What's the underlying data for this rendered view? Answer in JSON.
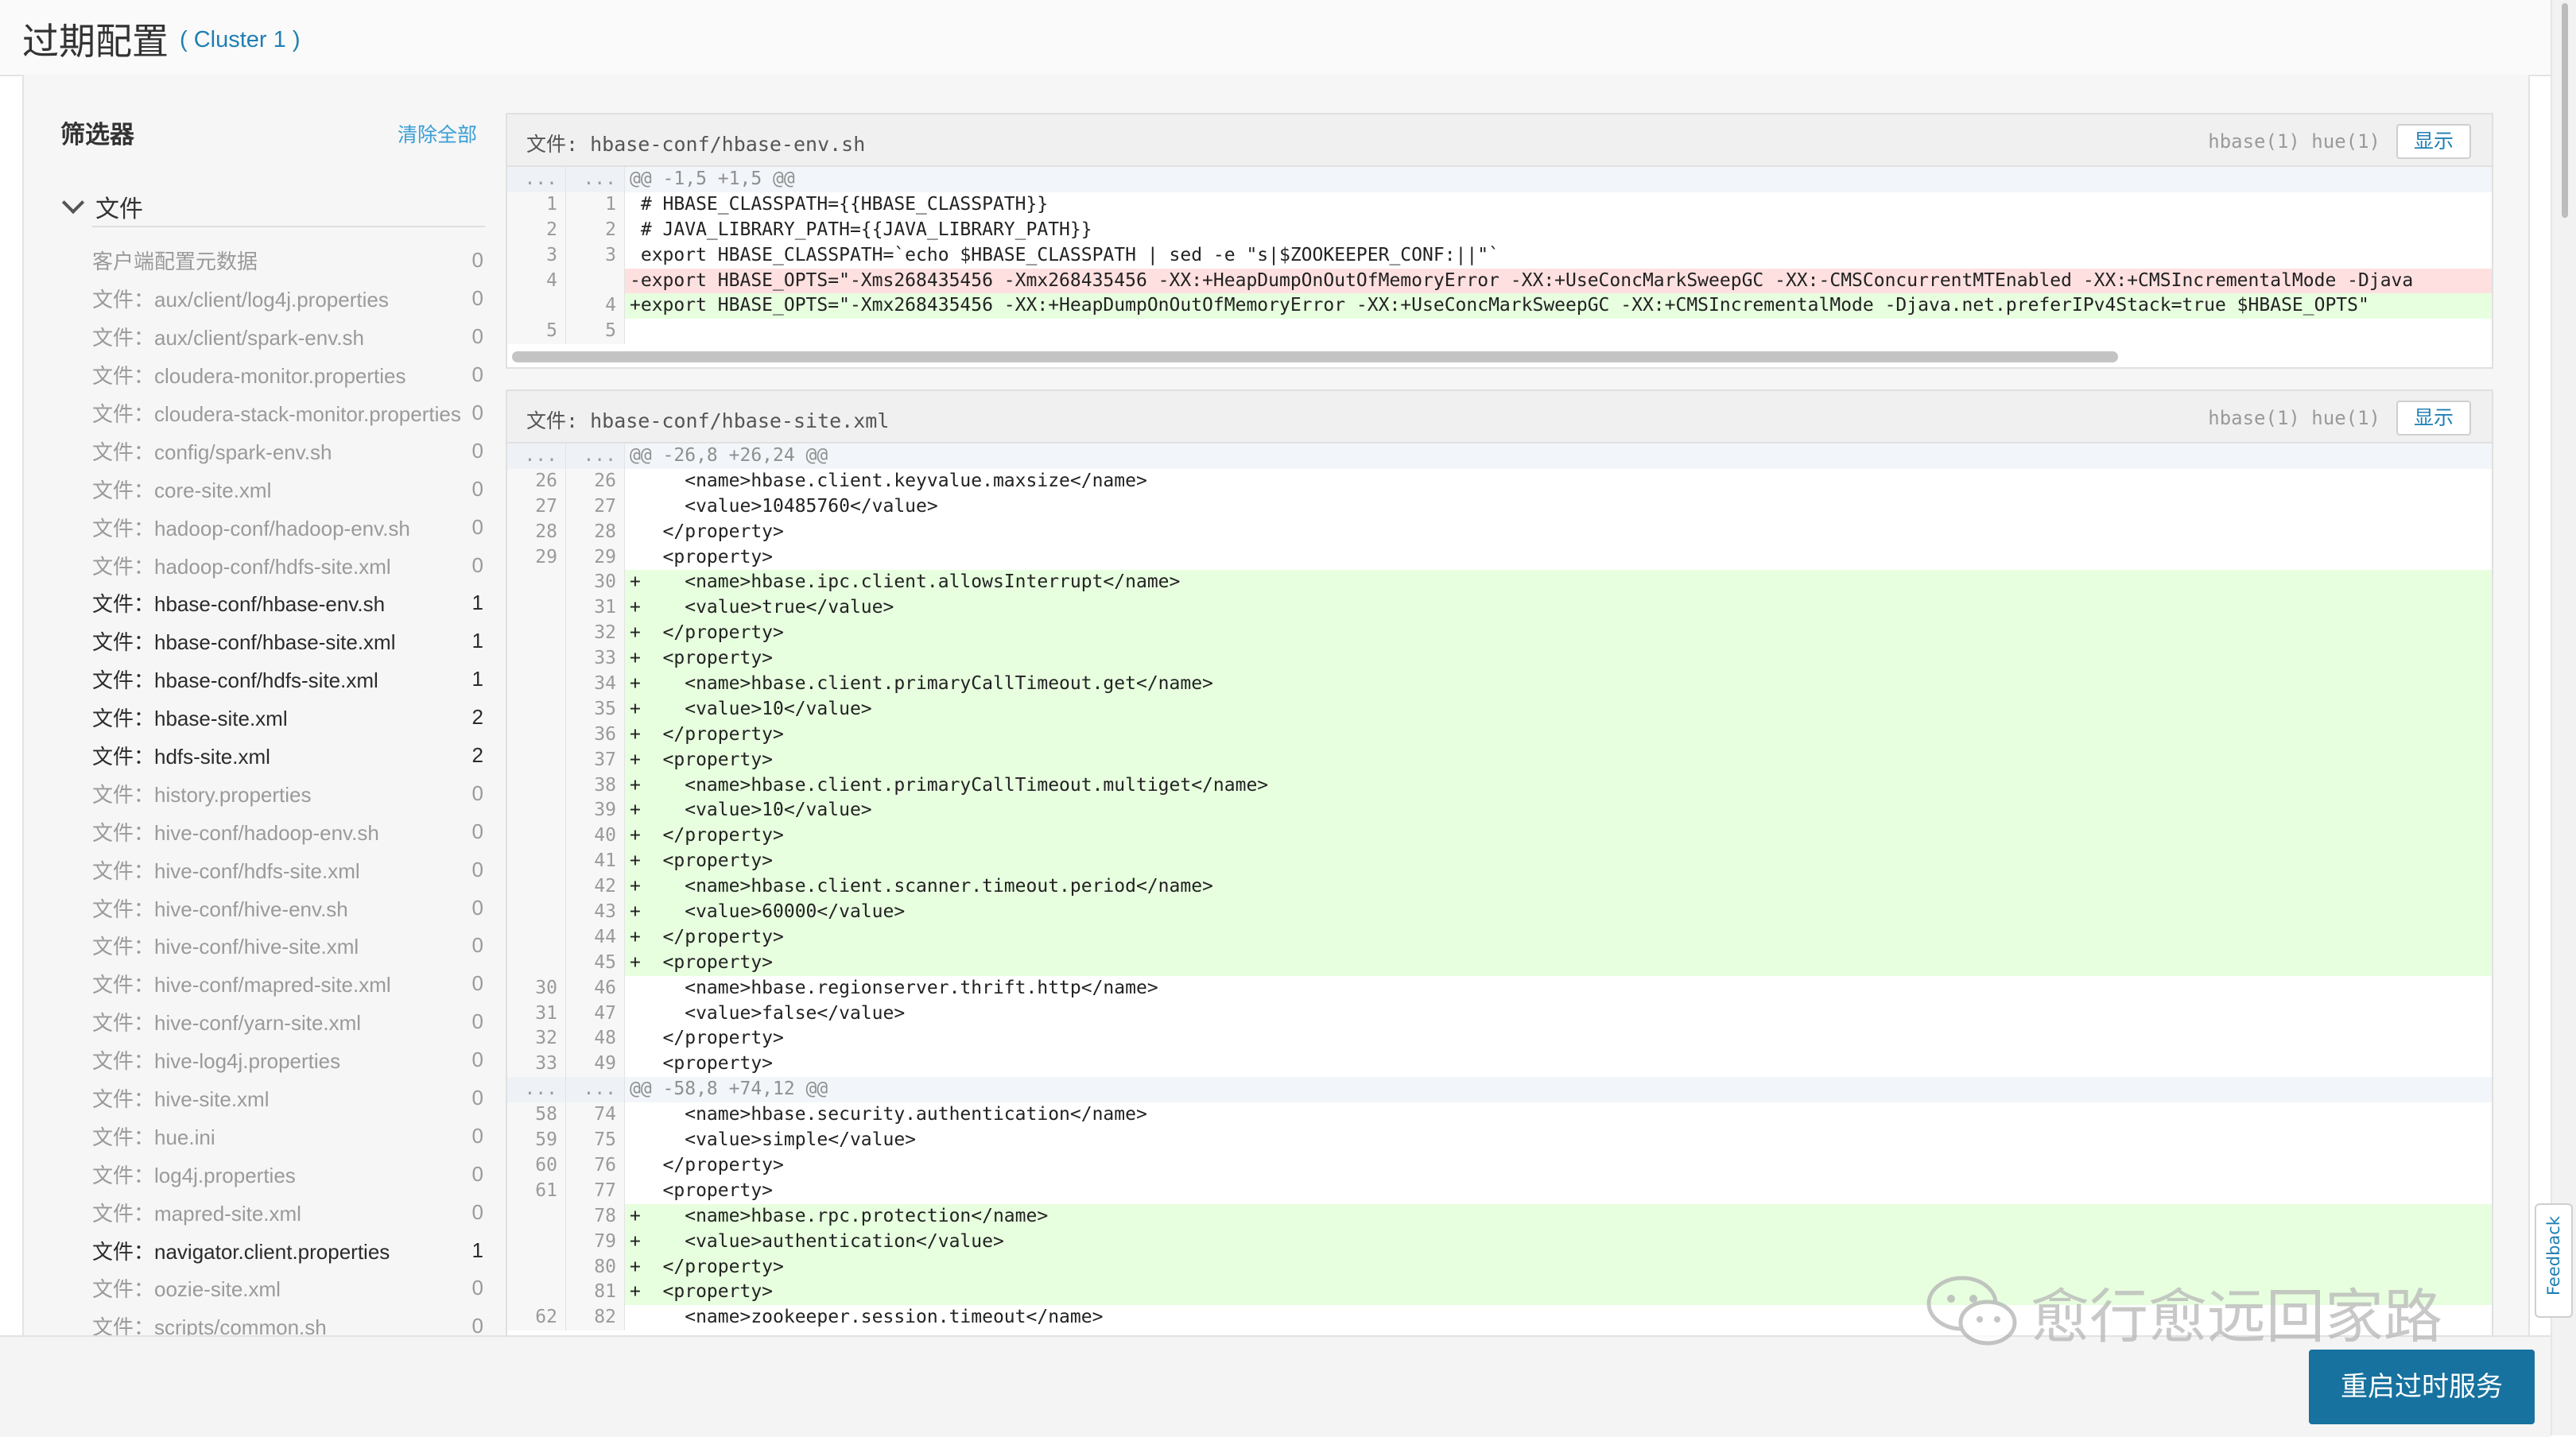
{
  "page": {
    "title": "过期配置",
    "cluster": "( Cluster 1 )"
  },
  "sidebar": {
    "filter_title": "筛选器",
    "clear_all": "清除全部",
    "section_title": "文件",
    "items": [
      {
        "label": "客户端配置元数据",
        "count": "0",
        "active": false
      },
      {
        "label": "文件：aux/client/log4j.properties",
        "count": "0",
        "active": false
      },
      {
        "label": "文件：aux/client/spark-env.sh",
        "count": "0",
        "active": false
      },
      {
        "label": "文件：cloudera-monitor.properties",
        "count": "0",
        "active": false
      },
      {
        "label": "文件：cloudera-stack-monitor.properties",
        "count": "0",
        "active": false
      },
      {
        "label": "文件：config/spark-env.sh",
        "count": "0",
        "active": false
      },
      {
        "label": "文件：core-site.xml",
        "count": "0",
        "active": false
      },
      {
        "label": "文件：hadoop-conf/hadoop-env.sh",
        "count": "0",
        "active": false
      },
      {
        "label": "文件：hadoop-conf/hdfs-site.xml",
        "count": "0",
        "active": false
      },
      {
        "label": "文件：hbase-conf/hbase-env.sh",
        "count": "1",
        "active": true
      },
      {
        "label": "文件：hbase-conf/hbase-site.xml",
        "count": "1",
        "active": true
      },
      {
        "label": "文件：hbase-conf/hdfs-site.xml",
        "count": "1",
        "active": true
      },
      {
        "label": "文件：hbase-site.xml",
        "count": "2",
        "active": true
      },
      {
        "label": "文件：hdfs-site.xml",
        "count": "2",
        "active": true
      },
      {
        "label": "文件：history.properties",
        "count": "0",
        "active": false
      },
      {
        "label": "文件：hive-conf/hadoop-env.sh",
        "count": "0",
        "active": false
      },
      {
        "label": "文件：hive-conf/hdfs-site.xml",
        "count": "0",
        "active": false
      },
      {
        "label": "文件：hive-conf/hive-env.sh",
        "count": "0",
        "active": false
      },
      {
        "label": "文件：hive-conf/hive-site.xml",
        "count": "0",
        "active": false
      },
      {
        "label": "文件：hive-conf/mapred-site.xml",
        "count": "0",
        "active": false
      },
      {
        "label": "文件：hive-conf/yarn-site.xml",
        "count": "0",
        "active": false
      },
      {
        "label": "文件：hive-log4j.properties",
        "count": "0",
        "active": false
      },
      {
        "label": "文件：hive-site.xml",
        "count": "0",
        "active": false
      },
      {
        "label": "文件：hue.ini",
        "count": "0",
        "active": false
      },
      {
        "label": "文件：log4j.properties",
        "count": "0",
        "active": false
      },
      {
        "label": "文件：mapred-site.xml",
        "count": "0",
        "active": false
      },
      {
        "label": "文件：navigator.client.properties",
        "count": "1",
        "active": true
      },
      {
        "label": "文件：oozie-site.xml",
        "count": "0",
        "active": false
      },
      {
        "label": "文件：scripts/common.sh",
        "count": "0",
        "active": false
      }
    ]
  },
  "panels": [
    {
      "file": "文件: hbase-conf/hbase-env.sh",
      "services": "hbase(1) hue(1)",
      "show_label": "显示",
      "lines": [
        {
          "old": "...",
          "new": "...",
          "type": "hunk",
          "text": "@@ -1,5 +1,5 @@"
        },
        {
          "old": "1",
          "new": "1",
          "type": "ctx",
          "text": " # HBASE_CLASSPATH={{HBASE_CLASSPATH}}"
        },
        {
          "old": "2",
          "new": "2",
          "type": "ctx",
          "text": " # JAVA_LIBRARY_PATH={{JAVA_LIBRARY_PATH}}"
        },
        {
          "old": "3",
          "new": "3",
          "type": "ctx",
          "text": " export HBASE_CLASSPATH=`echo $HBASE_CLASSPATH | sed -e \"s|$ZOOKEEPER_CONF:||\"`"
        },
        {
          "old": "4",
          "new": "",
          "type": "del",
          "text": "-export HBASE_OPTS=\"-Xms268435456 -Xmx268435456 -XX:+HeapDumpOnOutOfMemoryError -XX:+UseConcMarkSweepGC -XX:-CMSConcurrentMTEnabled -XX:+CMSIncrementalMode -Djava"
        },
        {
          "old": "",
          "new": "4",
          "type": "add",
          "text": "+export HBASE_OPTS=\"-Xmx268435456 -XX:+HeapDumpOnOutOfMemoryError -XX:+UseConcMarkSweepGC -XX:+CMSIncrementalMode -Djava.net.preferIPv4Stack=true $HBASE_OPTS\""
        },
        {
          "old": "5",
          "new": "5",
          "type": "ctx",
          "text": ""
        }
      ]
    },
    {
      "file": "文件: hbase-conf/hbase-site.xml",
      "services": "hbase(1) hue(1)",
      "show_label": "显示",
      "lines": [
        {
          "old": "...",
          "new": "...",
          "type": "hunk",
          "text": "@@ -26,8 +26,24 @@"
        },
        {
          "old": "26",
          "new": "26",
          "type": "ctx",
          "text": "     <name>hbase.client.keyvalue.maxsize</name>"
        },
        {
          "old": "27",
          "new": "27",
          "type": "ctx",
          "text": "     <value>10485760</value>"
        },
        {
          "old": "28",
          "new": "28",
          "type": "ctx",
          "text": "   </property>"
        },
        {
          "old": "29",
          "new": "29",
          "type": "ctx",
          "text": "   <property>"
        },
        {
          "old": "",
          "new": "30",
          "type": "add",
          "text": "+    <name>hbase.ipc.client.allowsInterrupt</name>"
        },
        {
          "old": "",
          "new": "31",
          "type": "add",
          "text": "+    <value>true</value>"
        },
        {
          "old": "",
          "new": "32",
          "type": "add",
          "text": "+  </property>"
        },
        {
          "old": "",
          "new": "33",
          "type": "add",
          "text": "+  <property>"
        },
        {
          "old": "",
          "new": "34",
          "type": "add",
          "text": "+    <name>hbase.client.primaryCallTimeout.get</name>"
        },
        {
          "old": "",
          "new": "35",
          "type": "add",
          "text": "+    <value>10</value>"
        },
        {
          "old": "",
          "new": "36",
          "type": "add",
          "text": "+  </property>"
        },
        {
          "old": "",
          "new": "37",
          "type": "add",
          "text": "+  <property>"
        },
        {
          "old": "",
          "new": "38",
          "type": "add",
          "text": "+    <name>hbase.client.primaryCallTimeout.multiget</name>"
        },
        {
          "old": "",
          "new": "39",
          "type": "add",
          "text": "+    <value>10</value>"
        },
        {
          "old": "",
          "new": "40",
          "type": "add",
          "text": "+  </property>"
        },
        {
          "old": "",
          "new": "41",
          "type": "add",
          "text": "+  <property>"
        },
        {
          "old": "",
          "new": "42",
          "type": "add",
          "text": "+    <name>hbase.client.scanner.timeout.period</name>"
        },
        {
          "old": "",
          "new": "43",
          "type": "add",
          "text": "+    <value>60000</value>"
        },
        {
          "old": "",
          "new": "44",
          "type": "add",
          "text": "+  </property>"
        },
        {
          "old": "",
          "new": "45",
          "type": "add",
          "text": "+  <property>"
        },
        {
          "old": "30",
          "new": "46",
          "type": "ctx",
          "text": "     <name>hbase.regionserver.thrift.http</name>"
        },
        {
          "old": "31",
          "new": "47",
          "type": "ctx",
          "text": "     <value>false</value>"
        },
        {
          "old": "32",
          "new": "48",
          "type": "ctx",
          "text": "   </property>"
        },
        {
          "old": "33",
          "new": "49",
          "type": "ctx",
          "text": "   <property>"
        },
        {
          "old": "...",
          "new": "...",
          "type": "hunk",
          "text": "@@ -58,8 +74,12 @@"
        },
        {
          "old": "58",
          "new": "74",
          "type": "ctx",
          "text": "     <name>hbase.security.authentication</name>"
        },
        {
          "old": "59",
          "new": "75",
          "type": "ctx",
          "text": "     <value>simple</value>"
        },
        {
          "old": "60",
          "new": "76",
          "type": "ctx",
          "text": "   </property>"
        },
        {
          "old": "61",
          "new": "77",
          "type": "ctx",
          "text": "   <property>"
        },
        {
          "old": "",
          "new": "78",
          "type": "add",
          "text": "+    <name>hbase.rpc.protection</name>"
        },
        {
          "old": "",
          "new": "79",
          "type": "add",
          "text": "+    <value>authentication</value>"
        },
        {
          "old": "",
          "new": "80",
          "type": "add",
          "text": "+  </property>"
        },
        {
          "old": "",
          "new": "81",
          "type": "add",
          "text": "+  <property>"
        },
        {
          "old": "62",
          "new": "82",
          "type": "ctx",
          "text": "     <name>zookeeper.session.timeout</name>"
        }
      ]
    }
  ],
  "footer": {
    "restart_label": "重启过时服务"
  },
  "feedback_label": "Feedback",
  "watermark": {
    "text": "愈行愈远回家路",
    "icon": "wechat-icon"
  },
  "colors": {
    "accent": "#1f7fb3",
    "button": "#17729f",
    "added_bg": "#e7ffdf",
    "deleted_bg": "#ffe0e0"
  }
}
